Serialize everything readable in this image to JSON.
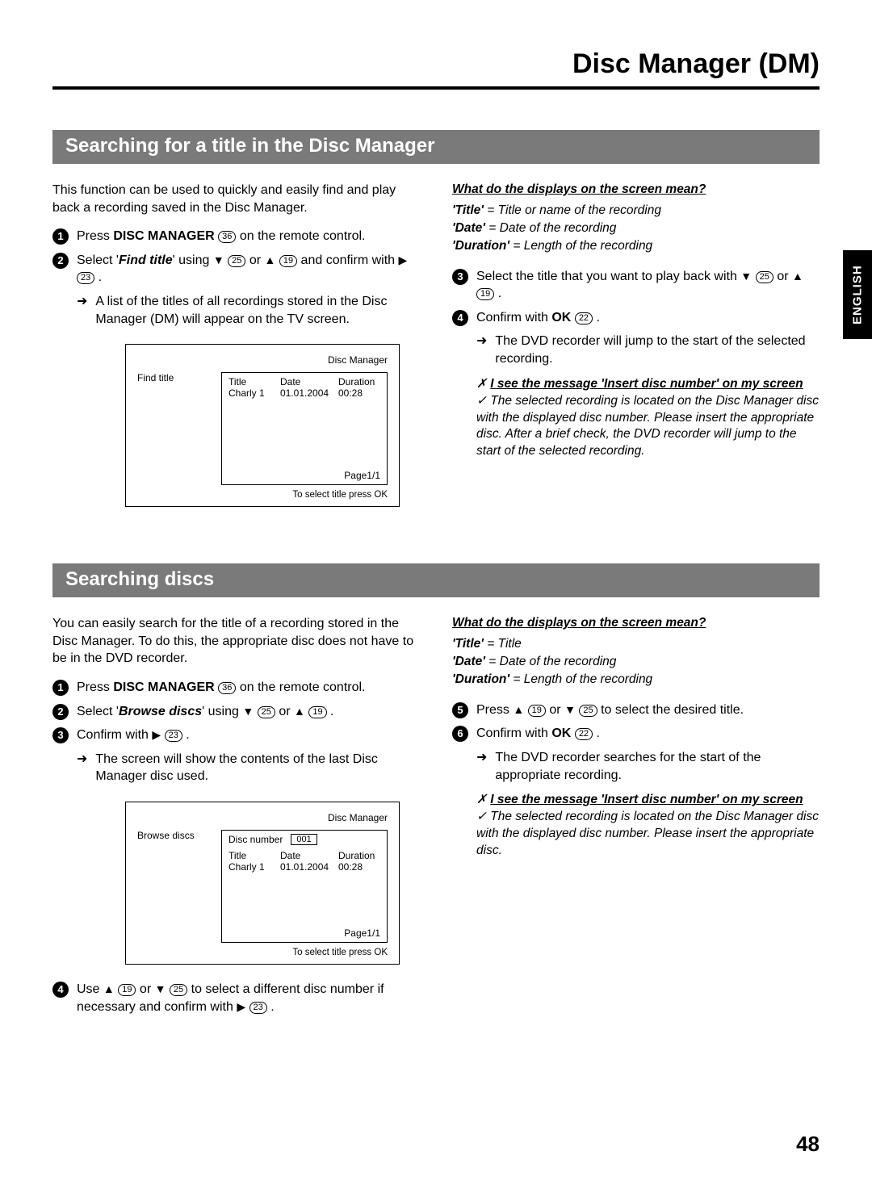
{
  "page": {
    "title": "Disc Manager (DM)",
    "number": "48",
    "language_tab": "ENGLISH"
  },
  "keys": {
    "down": "25",
    "up": "19",
    "right": "23",
    "ok": "22",
    "disc_manager": "36"
  },
  "section1": {
    "bar": "Searching for a title in the Disc Manager",
    "intro": "This function can be used to quickly and easily find and play back a recording saved in the Disc Manager.",
    "step1_a": "Press",
    "step1_b": "DISC MANAGER",
    "step1_c": "on the remote control.",
    "step2_a": "Select '",
    "step2_b": "Find title",
    "step2_c": "' using",
    "step2_d": "or",
    "step2_e": "and confirm with",
    "sub2": "A list of the titles of all recordings stored in the Disc Manager (DM) will appear on the TV screen.",
    "info_title": "What do the displays on the screen mean?",
    "info1_k": "'Title'",
    "info1_v": " = Title or name of the recording",
    "info2_k": "'Date'",
    "info2_v": " = Date of the recording",
    "info3_k": "'Duration'",
    "info3_v": " = Length of the recording",
    "step3_a": "Select the title that you want to play back with",
    "step3_b": "or",
    "step4_a": "Confirm with",
    "step4_b": "OK",
    "sub4": "The DVD recorder will jump to the start of the selected recording.",
    "note_title_a": "I see the message '",
    "note_title_b": "Insert disc number",
    "note_title_c": "' on my screen",
    "note_body": "The selected recording is located on the Disc Manager disc with the displayed disc number. Please insert the appropriate disc. After a brief check, the DVD recorder will jump to the start of the selected recording.",
    "screen": {
      "header": "Disc Manager",
      "left": "Find title",
      "col1": "Title",
      "col2": "Date",
      "col3": "Duration",
      "r1c1": "Charly 1",
      "r1c2": "01.01.2004",
      "r1c3": "00:28",
      "page": "Page1/1",
      "foot": "To select title press OK"
    }
  },
  "section2": {
    "bar": "Searching discs",
    "intro": "You can easily search for the title of a recording stored in the Disc Manager. To do this, the appropriate disc does not have to be in the DVD recorder.",
    "step1_a": "Press",
    "step1_b": "DISC MANAGER",
    "step1_c": "on the remote control.",
    "step2_a": "Select '",
    "step2_b": "Browse discs",
    "step2_c": "' using",
    "step2_d": "or",
    "step3_a": "Confirm with",
    "sub3": "The screen will show the contents of the last Disc Manager disc used.",
    "step4_a": "Use",
    "step4_b": "or",
    "step4_c": "to select a different disc number if necessary and confirm with",
    "info_title": "What do the displays on the screen mean?",
    "info1_k": "'Title'",
    "info1_v": " = Title",
    "info2_k": "'Date'",
    "info2_v": " = Date of the recording",
    "info3_k": "'Duration'",
    "info3_v": " = Length of the recording",
    "step5_a": "Press",
    "step5_b": "or",
    "step5_c": "to select the desired title.",
    "step6_a": "Confirm with",
    "step6_b": "OK",
    "sub6": "The DVD recorder searches for the start of the appropriate recording.",
    "note_title_a": "I see the message '",
    "note_title_b": "Insert disc number",
    "note_title_c": "' on my screen",
    "note_body": "The selected recording is located on the Disc Manager disc with the displayed disc number. Please insert the appropriate disc.",
    "screen": {
      "header": "Disc Manager",
      "left": "Browse discs",
      "discnum_label": "Disc number",
      "discnum_value": "001",
      "col1": "Title",
      "col2": "Date",
      "col3": "Duration",
      "r1c1": "Charly 1",
      "r1c2": "01.01.2004",
      "r1c3": "00:28",
      "page": "Page1/1",
      "foot": "To select title press OK"
    }
  }
}
